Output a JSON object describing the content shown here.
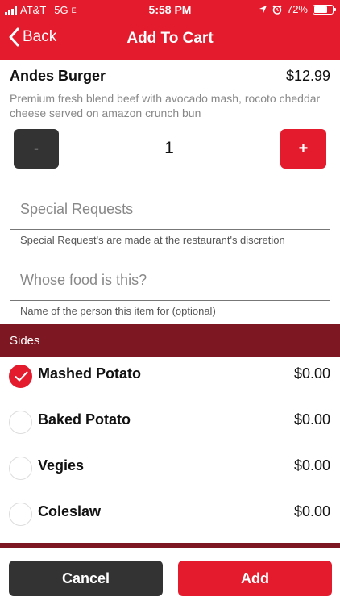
{
  "status_bar": {
    "carrier": "AT&T",
    "network": "5G",
    "network_suffix": "E",
    "time": "5:58 PM",
    "battery": "72%",
    "battery_level": 0.72
  },
  "nav": {
    "back_label": "Back",
    "title": "Add To Cart"
  },
  "item": {
    "name": "Andes Burger",
    "price": "$12.99",
    "description": "Premium fresh blend beef with avocado mash, rocoto cheddar cheese served on amazon crunch bun"
  },
  "quantity": {
    "minus_label": "-",
    "value": "1",
    "plus_label": "+"
  },
  "special_requests": {
    "placeholder": "Special Requests",
    "hint": "Special Request's are made at the restaurant's discretion"
  },
  "whose_food": {
    "placeholder": "Whose food is this?",
    "hint": "Name of the person this item for (optional)"
  },
  "sides": {
    "header": "Sides",
    "options": [
      {
        "name": "Mashed Potato",
        "price": "$0.00",
        "selected": true
      },
      {
        "name": "Baked Potato",
        "price": "$0.00",
        "selected": false
      },
      {
        "name": "Vegies",
        "price": "$0.00",
        "selected": false
      },
      {
        "name": "Coleslaw",
        "price": "$0.00",
        "selected": false
      }
    ]
  },
  "footer": {
    "cancel_label": "Cancel",
    "add_label": "Add"
  },
  "colors": {
    "brand_red": "#e31b2c",
    "section_maroon": "#7d1721",
    "dark_button": "#333333"
  }
}
